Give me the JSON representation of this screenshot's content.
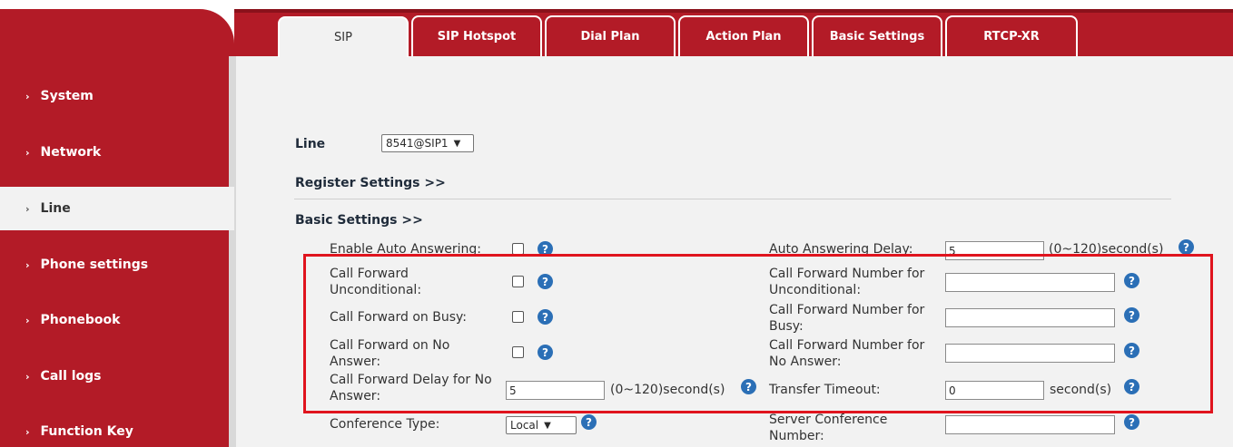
{
  "tabs": [
    "SIP",
    "SIP Hotspot",
    "Dial Plan",
    "Action Plan",
    "Basic Settings",
    "RTCP-XR"
  ],
  "sidebar": [
    "System",
    "Network",
    "Line",
    "Phone settings",
    "Phonebook",
    "Call logs",
    "Function Key"
  ],
  "line": {
    "label": "Line",
    "value": "8541@SIP1"
  },
  "register_settings": "Register Settings >>",
  "basic_settings": "Basic Settings >>",
  "fields": {
    "auto_answer": "Enable Auto Answering:",
    "auto_delay": "Auto Answering Delay:",
    "auto_delay_value": "5",
    "auto_delay_unit": "(0~120)second(s)",
    "cf_uncond_1": "Call Forward",
    "cf_uncond_2": "Unconditional:",
    "cfn_uncond_1": "Call Forward Number for",
    "cfn_uncond_2": "Unconditional:",
    "cf_busy": "Call Forward on Busy:",
    "cfn_busy_1": "Call Forward Number for",
    "cfn_busy_2": "Busy:",
    "cf_noans_1": "Call Forward on No",
    "cf_noans_2": "Answer:",
    "cfn_noans_1": "Call Forward Number for",
    "cfn_noans_2": "No Answer:",
    "cf_delay_1": "Call Forward Delay for No",
    "cf_delay_2": "Answer:",
    "cf_delay_value": "5",
    "cf_delay_unit": "(0~120)second(s)",
    "transfer_timeout": "Transfer Timeout:",
    "transfer_timeout_value": "0",
    "transfer_timeout_unit": "second(s)",
    "conference_type": "Conference Type:",
    "conference_type_value": "Local",
    "server_conf_1": "Server Conference",
    "server_conf_2": "Number:"
  },
  "help_glyph": "?",
  "chevron": "›",
  "caret": "▼",
  "colors": {
    "brand_red": "#b31b27",
    "highlight": "#e0141e",
    "help_blue": "#2b6fb6"
  }
}
